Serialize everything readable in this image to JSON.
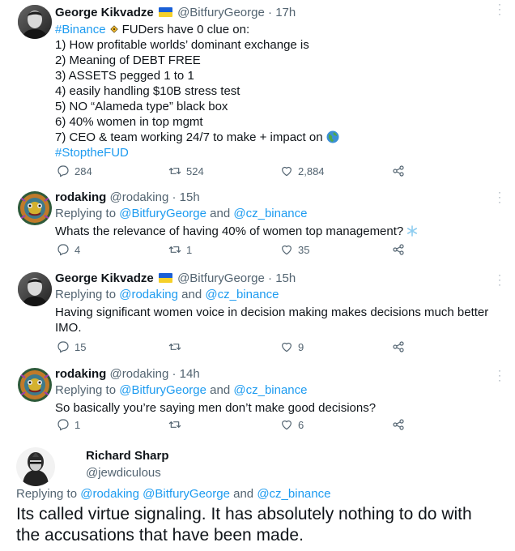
{
  "colors": {
    "link": "#1d9bf0",
    "muted": "#536471",
    "text": "#0f1419"
  },
  "tweets": [
    {
      "name": "George Kikvadze",
      "handle": "@BitfuryGeorge",
      "time": "17h",
      "flag": "ukraine-flag",
      "lines": [
        "FUDers have 0 clue on:",
        "1) How profitable worlds’ dominant exchange is",
        "2) Meaning of DEBT FREE",
        "3) ASSETS pegged 1 to 1",
        "4) easily handling $10B stress test",
        "5) NO “Alameda type” black box",
        "6) 40% women in top mgmt",
        "7) CEO & team working 24/7 to make + impact on",
        "#StoptheFUD"
      ],
      "hashtag_start": "#Binance",
      "replies": "284",
      "retweets": "524",
      "likes": "2,884"
    },
    {
      "name": "rodaking",
      "handle": "@rodaking",
      "time": "15h",
      "replying_prefix": "Replying to",
      "replying_to": [
        "@BitfuryGeorge",
        "@cz_binance"
      ],
      "replying_and": "and",
      "text": "Whats the relevance of having 40% of women top management?",
      "replies": "4",
      "retweets": "1",
      "likes": "35"
    },
    {
      "name": "George Kikvadze",
      "handle": "@BitfuryGeorge",
      "time": "15h",
      "flag": "ukraine-flag",
      "replying_prefix": "Replying to",
      "replying_to": [
        "@rodaking",
        "@cz_binance"
      ],
      "replying_and": "and",
      "text_lines": [
        "Having significant women voice in decision making makes decisions much better",
        "IMO."
      ],
      "replies": "15",
      "retweets": "",
      "likes": "9"
    },
    {
      "name": "rodaking",
      "handle": "@rodaking",
      "time": "14h",
      "replying_prefix": "Replying to",
      "replying_to": [
        "@BitfuryGeorge",
        "@cz_binance"
      ],
      "replying_and": "and",
      "text": "So basically you’re saying men don’t make good decisions?",
      "replies": "1",
      "retweets": "",
      "likes": "6"
    }
  ],
  "final_tweet": {
    "name": "Richard Sharp",
    "handle": "@jewdiculous",
    "replying_prefix": "Replying to",
    "replying_to": [
      "@rodaking",
      "@BitfuryGeorge",
      "@cz_binance"
    ],
    "replying_and": "and",
    "text_lines": [
      "Its called virtue signaling. It has absolutely nothing to do with",
      "the accusations that have been made."
    ]
  },
  "separator_dot": "·"
}
